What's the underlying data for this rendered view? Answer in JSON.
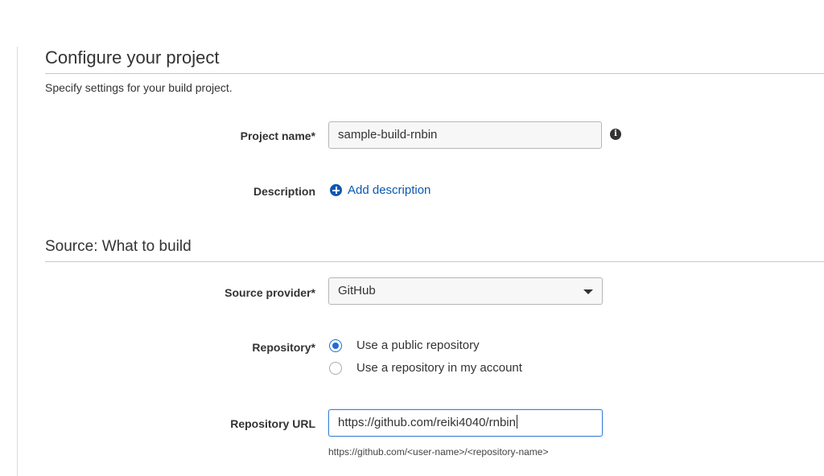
{
  "sections": {
    "configure": {
      "title": "Configure your project",
      "subtitle": "Specify settings for your build project."
    },
    "source": {
      "title": "Source: What to build"
    }
  },
  "fields": {
    "project_name": {
      "label": "Project name*",
      "value": "sample-build-rnbin",
      "icon": "info-icon"
    },
    "description": {
      "label": "Description",
      "link": "Add description",
      "icon": "plus-circle-icon"
    },
    "source_provider": {
      "label": "Source provider*",
      "selected": "GitHub"
    },
    "repository": {
      "label": "Repository*",
      "options": [
        "Use a public repository",
        "Use a repository in my account"
      ],
      "selected_index": 0
    },
    "repository_url": {
      "label": "Repository URL",
      "value": "https://github.com/reiki4040/rnbin",
      "hint": "https://github.com/<user-name>/<repository-name>"
    }
  },
  "colors": {
    "link": "#0a57b3",
    "radio_selected": "#1f6fd1",
    "focus_border": "#3d7fd6"
  }
}
